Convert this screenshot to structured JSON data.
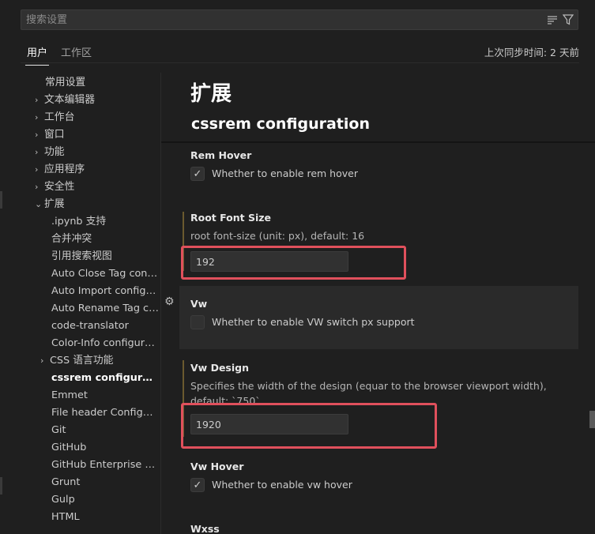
{
  "search": {
    "placeholder": "搜索设置"
  },
  "tabs": {
    "user": "用户",
    "workspace": "工作区"
  },
  "sync_status": "上次同步时间: 2 天前",
  "toc": {
    "items": [
      {
        "label": "常用设置",
        "chevron": ""
      },
      {
        "label": "文本编辑器",
        "chevron": "›"
      },
      {
        "label": "工作台",
        "chevron": "›"
      },
      {
        "label": "窗口",
        "chevron": "›"
      },
      {
        "label": "功能",
        "chevron": "›"
      },
      {
        "label": "应用程序",
        "chevron": "›"
      },
      {
        "label": "安全性",
        "chevron": "›"
      },
      {
        "label": "扩展",
        "chevron": "⌄"
      },
      {
        "label": ".ipynb 支持"
      },
      {
        "label": "合并冲突"
      },
      {
        "label": "引用搜索视图"
      },
      {
        "label": "Auto Close Tag configu..."
      },
      {
        "label": "Auto Import configura..."
      },
      {
        "label": "Auto Rename Tag con..."
      },
      {
        "label": "code-translator"
      },
      {
        "label": "Color-Info configurati..."
      },
      {
        "label": "CSS 语言功能",
        "chevron": "›"
      },
      {
        "label": "cssrem configuration"
      },
      {
        "label": "Emmet"
      },
      {
        "label": "File header Configurat..."
      },
      {
        "label": "Git"
      },
      {
        "label": "GitHub"
      },
      {
        "label": "GitHub Enterprise Ser..."
      },
      {
        "label": "Grunt"
      },
      {
        "label": "Gulp"
      },
      {
        "label": "HTML"
      }
    ]
  },
  "content": {
    "heading": "扩展",
    "category": "cssrem configuration",
    "settings": {
      "rem_hover": {
        "title": "Rem Hover",
        "label": "Whether to enable rem hover",
        "checked": "✓"
      },
      "root_font_size": {
        "title": "Root Font Size",
        "desc": "root font-size (unit: px), default: 16",
        "value": "192"
      },
      "vw": {
        "title": "Vw",
        "label": "Whether to enable VW switch px support",
        "checked": ""
      },
      "vw_design": {
        "title": "Vw Design",
        "desc": "Specifies the width of the design (equar to the browser viewport width), default: `750`",
        "value": "1920"
      },
      "vw_hover": {
        "title": "Vw Hover",
        "label": "Whether to enable vw hover",
        "checked": "✓"
      },
      "wxss": {
        "title": "Wxss"
      }
    }
  },
  "colors": {
    "highlight": "#e0505c",
    "modified_bar": "#6b5a2f",
    "background": "#1f1f1f"
  },
  "icons": [
    "clear-filter-icon",
    "filter-icon",
    "gear-icon",
    "check-icon",
    "chevron-right-icon",
    "chevron-down-icon"
  ]
}
